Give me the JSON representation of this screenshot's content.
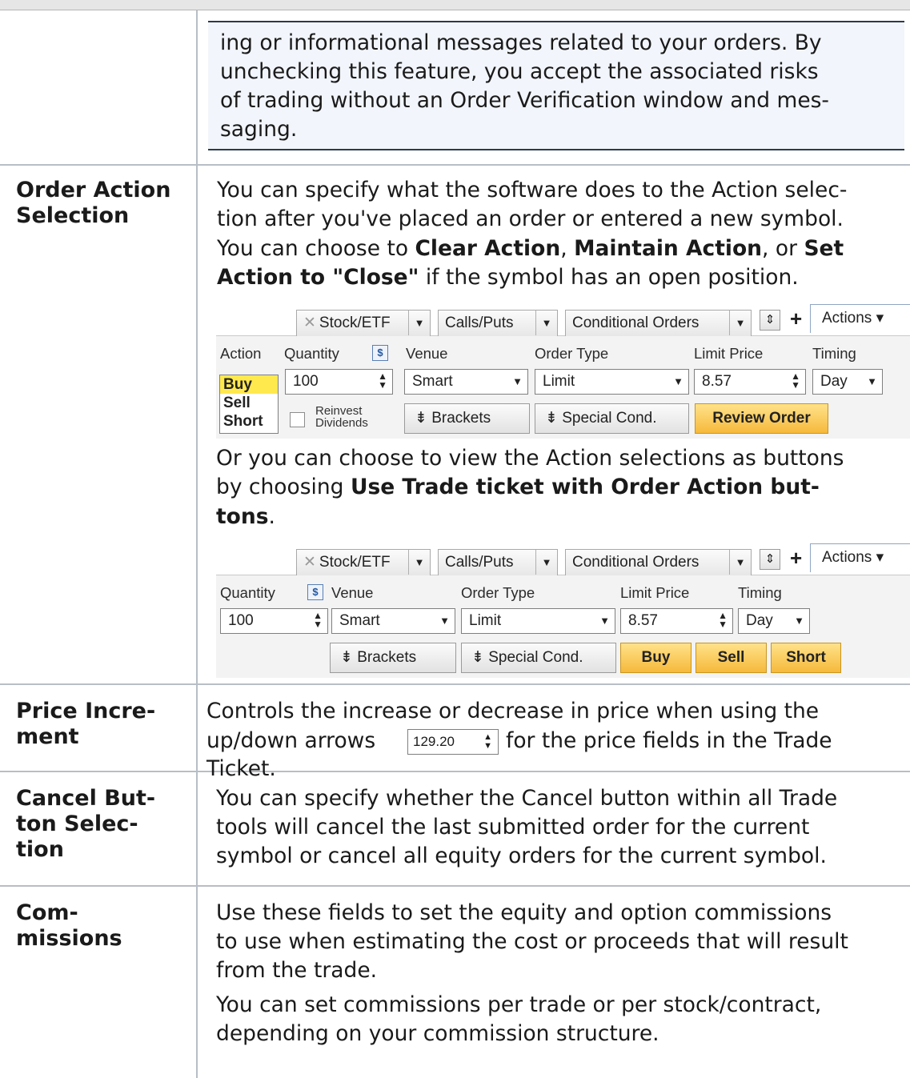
{
  "note": {
    "lines": [
      "ing or informational messages related to your orders. By",
      "unchecking this feature, you accept the associated risks",
      "of trading without an Order Verification window and mes-",
      "saging."
    ]
  },
  "rows": {
    "order_action": {
      "term_lines": [
        "Order Action",
        "Selection"
      ],
      "p1": {
        "line1": "You can specify what the software does to the Action selec-",
        "line2": "tion after you've placed an order or entered a new symbol.",
        "line3_pre": "You can choose to ",
        "line3_b1": "Clear Action",
        "line3_mid": ", ",
        "line3_b2": "Maintain Action",
        "line3_mid2": ", or ",
        "line3_b3": "Set",
        "line4_b": "Action to \"Close\"",
        "line4_post": " if the symbol has an open position."
      },
      "p2": {
        "line1": "Or you can choose to view the Action selections as buttons",
        "line2_pre": "by choosing ",
        "line2_b": "Use Trade ticket with Order Action but-",
        "line3_b": "tons",
        "line3_post": "."
      }
    },
    "price_increment": {
      "term_lines": [
        "Price Incre-",
        "ment"
      ],
      "line1": "Controls the increase or decrease in price when using the",
      "line2_pre": "up/down arrows",
      "line2_field": "129.20",
      "line2_post": "for the price fields in the Trade",
      "line3": "Ticket."
    },
    "cancel_button": {
      "term_lines": [
        "Cancel But-",
        "ton Selec-",
        "tion"
      ],
      "lines": [
        "You can specify whether the Cancel button within all Trade",
        "tools will cancel the last submitted order for the current",
        "symbol or cancel all equity orders for the current symbol."
      ]
    },
    "commissions": {
      "term_lines": [
        "Com-",
        "missions"
      ],
      "lines": [
        "Use these fields to set the equity and option commissions",
        "to use when estimating the cost or proceeds that will result",
        "from the trade.",
        "You can set commissions per trade or per stock/contract,",
        "depending on your commission structure."
      ]
    }
  },
  "ticket": {
    "tabs": [
      "Stock/ETF",
      "Calls/Puts",
      "Conditional Orders"
    ],
    "actions_label": "Actions",
    "plus": "+",
    "labels": {
      "action": "Action",
      "quantity": "Quantity",
      "venue": "Venue",
      "order_type": "Order Type",
      "limit_price": "Limit Price",
      "timing": "Timing"
    },
    "action_options": [
      "Buy",
      "Sell",
      "Short"
    ],
    "quantity": "100",
    "venue": "Smart",
    "order_type": "Limit",
    "limit_price": "8.57",
    "timing": "Day",
    "reinvest_lines": [
      "Reinvest",
      "Dividends"
    ],
    "brackets": "Brackets",
    "special_cond": "Special Cond.",
    "review_order": "Review Order",
    "buy": "Buy",
    "sell": "Sell",
    "short": "Short",
    "dollar": "$"
  }
}
